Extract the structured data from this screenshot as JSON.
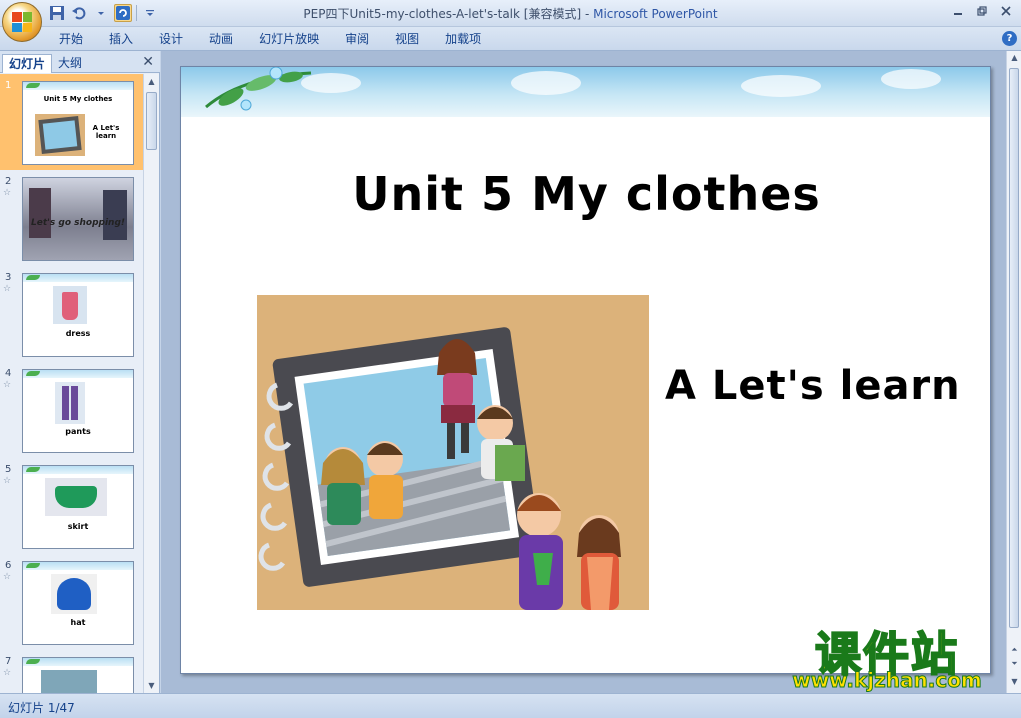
{
  "window": {
    "title": "PEP四下Unit5-my-clothes-A-let's-talk [兼容模式]",
    "separator": " - ",
    "app_name": "Microsoft PowerPoint"
  },
  "ribbon": {
    "tabs": [
      "开始",
      "插入",
      "设计",
      "动画",
      "幻灯片放映",
      "审阅",
      "视图",
      "加载项"
    ]
  },
  "left_panel": {
    "tab_slides": "幻灯片",
    "tab_outline": "大纲",
    "thumbnails": [
      {
        "num": "1",
        "label_title": "Unit 5 My clothes",
        "label_sub": "A Let's learn"
      },
      {
        "num": "2",
        "label": "Let's go shopping!"
      },
      {
        "num": "3",
        "label": "dress"
      },
      {
        "num": "4",
        "label": "pants"
      },
      {
        "num": "5",
        "label": "skirt"
      },
      {
        "num": "6",
        "label": "hat"
      },
      {
        "num": "7",
        "label": ""
      }
    ]
  },
  "slide": {
    "title": "Unit 5 My clothes",
    "subtitle": "A Let's learn"
  },
  "watermark": {
    "cn": "课件站",
    "url": "www.kjzhan.com"
  },
  "status": {
    "slide_indicator": "幻灯片 1/47"
  },
  "colors": {
    "selected_thumb": "#ffc16e",
    "ribbon_text": "#15428b",
    "watermark_fill": "#ffe000",
    "watermark_stroke": "#1a7a1a"
  }
}
